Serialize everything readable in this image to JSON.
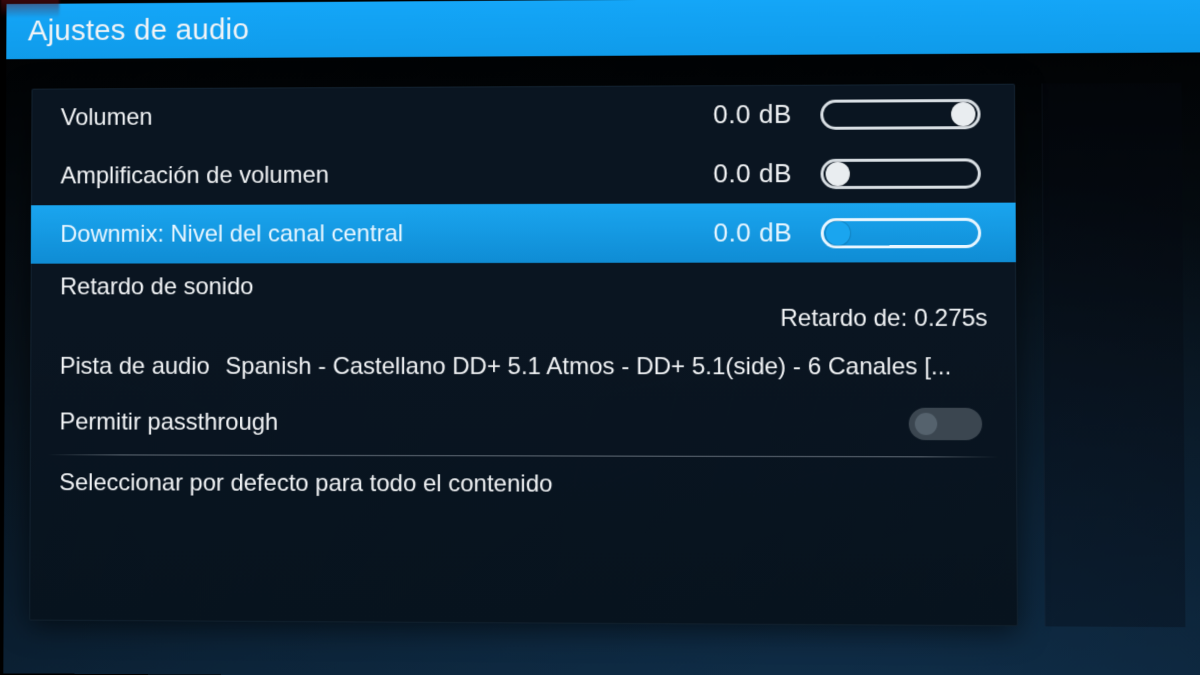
{
  "header": {
    "title": "Ajustes de audio"
  },
  "rows": {
    "volume": {
      "label": "Volumen",
      "value": "0.0 dB"
    },
    "amp": {
      "label": "Amplificación de volumen",
      "value": "0.0 dB"
    },
    "downmix": {
      "label": "Downmix: Nivel del canal central",
      "value": "0.0 dB"
    },
    "delay": {
      "label": "Retardo de sonido",
      "value": "Retardo de: 0.275s"
    },
    "track": {
      "label": "Pista de audio",
      "value": "Spanish - Castellano DD+ 5.1 Atmos - DD+ 5.1(side) - 6 Canales [..."
    },
    "passthrough": {
      "label": "Permitir passthrough"
    },
    "default": {
      "label": "Seleccionar por defecto para todo el contenido"
    }
  }
}
